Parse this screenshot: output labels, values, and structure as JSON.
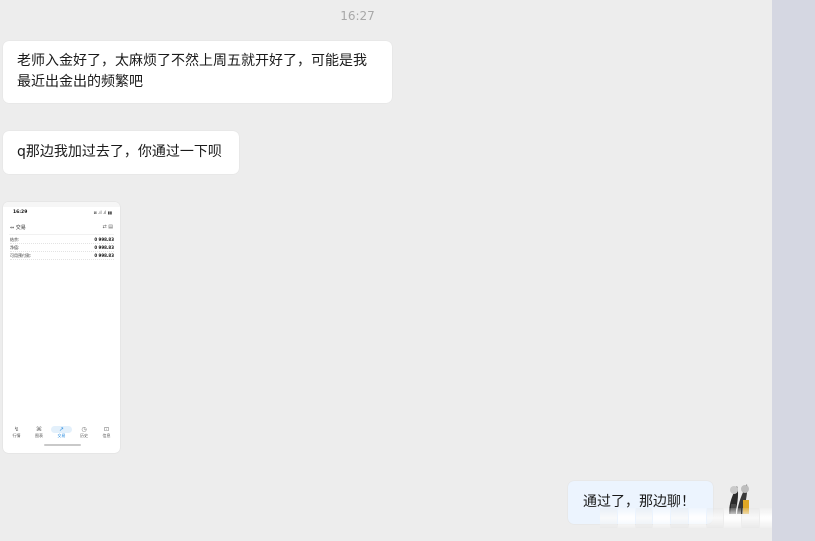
{
  "chat": {
    "timestamp": "16:27",
    "messages": [
      {
        "text": "老师入金好了，太麻烦了不然上周五就开好了，可能是我最近出金出的频繁吧"
      },
      {
        "text": "q那边我加过去了，你通过一下呗"
      }
    ],
    "outgoing": {
      "text": "通过了，那边聊！"
    }
  },
  "screenshot": {
    "time": "16:29",
    "signal": "⊠ .ıl .ıl ▮▮",
    "header_title": "⇔ 交易",
    "header_icons": "⇄   ▤",
    "rows": [
      {
        "label": "结余:",
        "value": "0 998.83"
      },
      {
        "label": "净值:",
        "value": "0 998.83"
      },
      {
        "label": "可用预付款:",
        "value": "0 998.83"
      }
    ],
    "nav": [
      {
        "icon": "↯",
        "label": "行情"
      },
      {
        "icon": "⌘",
        "label": "图表"
      },
      {
        "icon": "↗",
        "label": "交易"
      },
      {
        "icon": "◷",
        "label": "历史"
      },
      {
        "icon": "⊡",
        "label": "信息"
      }
    ]
  },
  "colors": {
    "background": "#ededed",
    "incoming_bubble": "#ffffff",
    "outgoing_bubble": "#ecf4fe",
    "side_strip": "#d5d7e2",
    "active_nav": "#2b8de0"
  }
}
